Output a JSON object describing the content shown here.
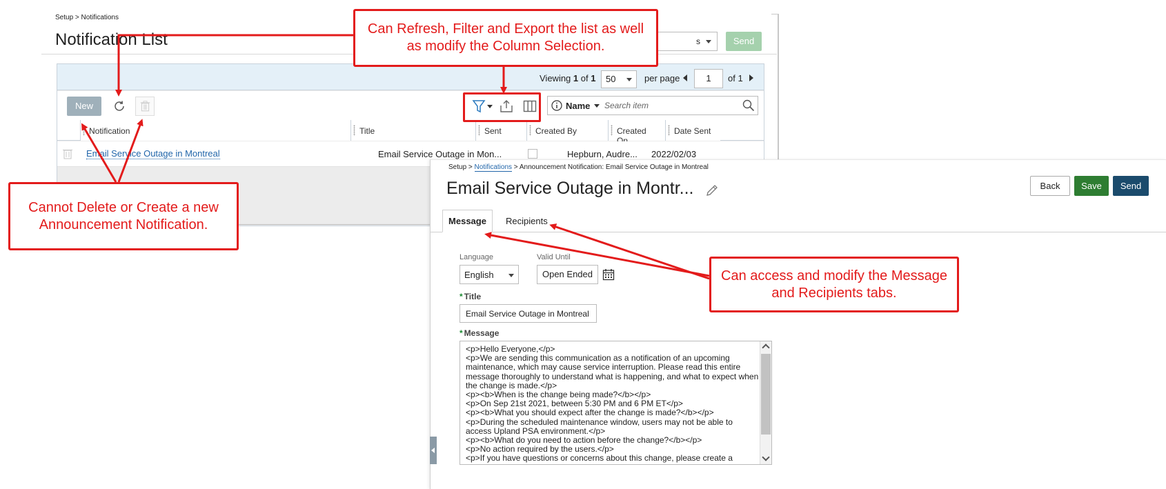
{
  "background": {
    "breadcrumb": "Setup > Notifications",
    "page_title": "Notification List",
    "top_select_value": "s",
    "send_label": "Send",
    "pager": {
      "viewing_prefix": "Viewing ",
      "viewing_current": "1",
      "viewing_of": " of ",
      "viewing_total": "1",
      "page_size": "50",
      "per_page": "per page",
      "page_number": "1",
      "of_pages": "of 1"
    },
    "toolbar": {
      "new_label": "New",
      "search_field": "Name",
      "search_placeholder": "Search item"
    },
    "columns": [
      "Notification",
      "Title",
      "Sent",
      "Created By",
      "Created On",
      "Date Sent"
    ],
    "row": {
      "notification": "Email Service Outage in Montreal",
      "title": "Email Service Outage in Mon...",
      "created_by": "Hepburn, Audre...",
      "created_on": "2022/02/03"
    }
  },
  "detail": {
    "breadcrumb_setup": "Setup > ",
    "breadcrumb_link": "Notifications",
    "breadcrumb_rest": " > Announcement Notification: Email Service Outage in Montreal",
    "title": "Email Service Outage in Montr...",
    "back_label": "Back",
    "save_label": "Save",
    "send_label": "Send",
    "tabs": [
      "Message",
      "Recipients"
    ],
    "language_label": "Language",
    "language_value": "English",
    "valid_until_label": "Valid Until",
    "valid_until_value": "Open Ended",
    "title_label": "Title",
    "title_value": "Email Service Outage in Montreal",
    "message_label": "Message",
    "message_text": "<p>Hello Everyone,</p>\n<p>We are sending this communication as a notification of an upcoming maintenance, which may cause service interruption. Please read this entire message thoroughly to understand what is happening, and what to expect when the change is made.</p>\n<p><b>When is the change being made?</b></p>\n<p>On Sep 21st 2021, between 5:30 PM and 6 PM ET</p>\n<p><b>What you should expect after the change is made?</b></p>\n<p>During the scheduled maintenance window, users may not be able to access Upland PSA environment.</p>\n<p><b>What do you need to action before the change?</b></p>\n<p>No action required by the users.</p>\n<p>If you have questions or concerns about this change, please create a support ticket.</p>"
  },
  "callouts": {
    "toolbar_note": "Can Refresh, Filter and Export the list as well as modify the Column Selection.",
    "delete_note": "Cannot Delete or Create a new Announcement Notification.",
    "tabs_note": "Can access and modify the Message and  Recipients tabs."
  },
  "colors": {
    "callout_red": "#e31b1b",
    "save_green": "#2e7d32",
    "send_navy": "#1b4b6c",
    "link_blue": "#2266aa"
  },
  "icons": [
    "refresh-icon",
    "trash-icon",
    "filter-icon",
    "export-icon",
    "columns-icon",
    "info-icon",
    "search-icon",
    "pencil-icon",
    "calendar-icon"
  ]
}
